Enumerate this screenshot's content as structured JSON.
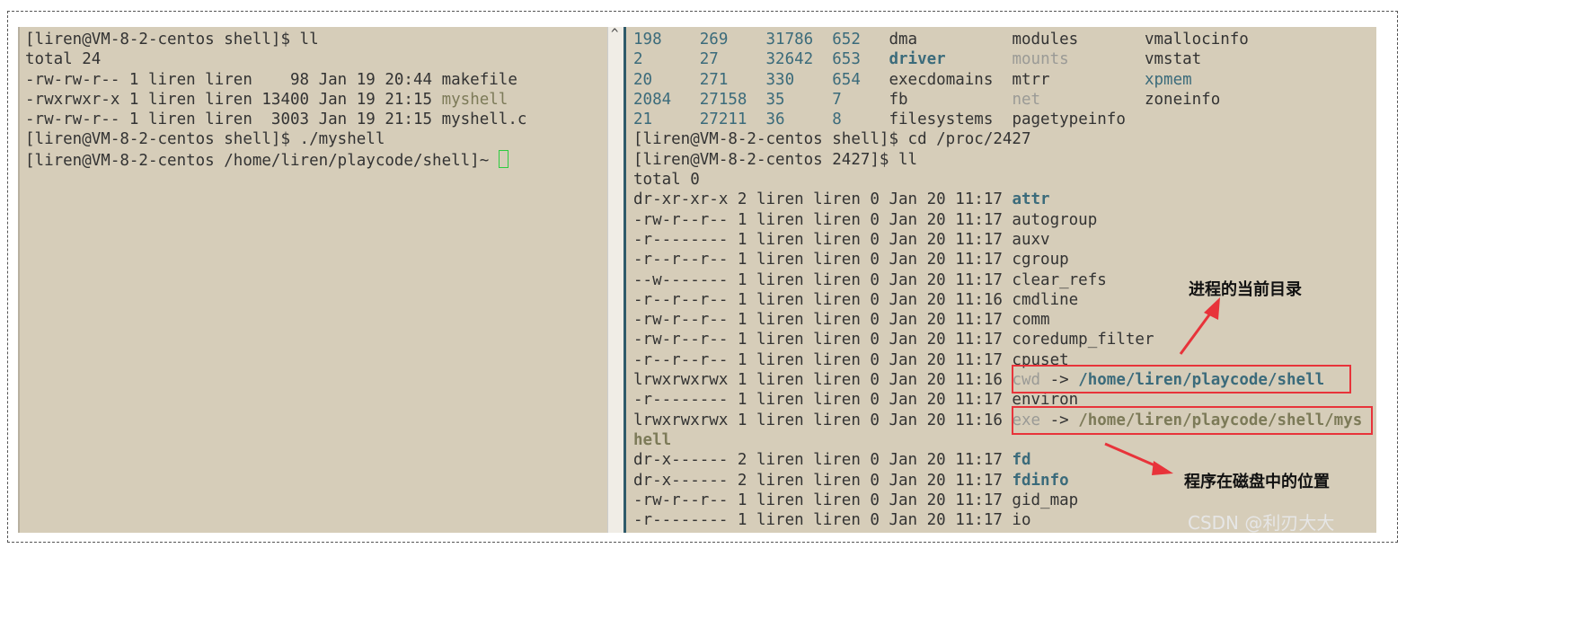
{
  "colors": {
    "background": "#d6cdb9",
    "blue": "#3b6b7b",
    "gray": "#9a9a96",
    "olive": "#7c7a58",
    "annotation": "#e8333a"
  },
  "left_terminal": {
    "lines": [
      [
        {
          "t": "[liren@VM-8-2-centos shell]$ ll"
        }
      ],
      [
        {
          "t": "total 24"
        }
      ],
      [
        {
          "t": "-rw-rw-r-- 1 liren liren    98 Jan 19 20:44 makefile"
        }
      ],
      [
        {
          "t": "-rwxrwxr-x 1 liren liren 13400 Jan 19 21:15 "
        },
        {
          "t": "myshell",
          "c": "olive"
        }
      ],
      [
        {
          "t": "-rw-rw-r-- 1 liren liren  3003 Jan 19 21:15 myshell.c"
        }
      ],
      [
        {
          "t": "[liren@VM-8-2-centos shell]$ ./myshell"
        }
      ],
      [
        {
          "t": "[liren@VM-8-2-centos /home/liren/playcode/shell]~ "
        },
        {
          "cursor": true
        }
      ]
    ]
  },
  "right_terminal": {
    "lines": [
      [
        {
          "t": "198    269    31786  652   ",
          "c": "blue"
        },
        {
          "t": "dma          modules       vmallocinfo"
        }
      ],
      [
        {
          "t": "2      27     32642  653   ",
          "c": "blue"
        },
        {
          "t": "driver",
          "c": "bblue"
        },
        {
          "t": "       "
        },
        {
          "t": "mounts",
          "c": "gray"
        },
        {
          "t": "        vmstat"
        }
      ],
      [
        {
          "t": "20     271    330    654   ",
          "c": "blue"
        },
        {
          "t": "execdomains  mtrr          "
        },
        {
          "t": "xpmem",
          "c": "blue"
        }
      ],
      [
        {
          "t": "2084   27158  35     7     ",
          "c": "blue"
        },
        {
          "t": "fb           "
        },
        {
          "t": "net",
          "c": "gray"
        },
        {
          "t": "           zoneinfo"
        }
      ],
      [
        {
          "t": "21     27211  36     8     ",
          "c": "blue"
        },
        {
          "t": "filesystems  pagetypeinfo"
        }
      ],
      [
        {
          "t": "[liren@VM-8-2-centos shell]$ cd /proc/2427"
        }
      ],
      [
        {
          "t": "[liren@VM-8-2-centos 2427]$ ll"
        }
      ],
      [
        {
          "t": "total 0"
        }
      ],
      [
        {
          "t": "dr-xr-xr-x 2 liren liren 0 Jan 20 11:17 "
        },
        {
          "t": "attr",
          "c": "bblue"
        }
      ],
      [
        {
          "t": "-rw-r--r-- 1 liren liren 0 Jan 20 11:17 autogroup"
        }
      ],
      [
        {
          "t": "-r-------- 1 liren liren 0 Jan 20 11:17 auxv"
        }
      ],
      [
        {
          "t": "-r--r--r-- 1 liren liren 0 Jan 20 11:17 cgroup"
        }
      ],
      [
        {
          "t": "--w------- 1 liren liren 0 Jan 20 11:17 clear_refs"
        }
      ],
      [
        {
          "t": "-r--r--r-- 1 liren liren 0 Jan 20 11:16 cmdline"
        }
      ],
      [
        {
          "t": "-rw-r--r-- 1 liren liren 0 Jan 20 11:17 comm"
        }
      ],
      [
        {
          "t": "-rw-r--r-- 1 liren liren 0 Jan 20 11:17 coredump_filter"
        }
      ],
      [
        {
          "t": "-r--r--r-- 1 liren liren 0 Jan 20 11:17 cpuset"
        }
      ],
      [
        {
          "t": "lrwxrwxrwx 1 liren liren 0 Jan 20 11:16 "
        },
        {
          "t": "cwd",
          "c": "gray"
        },
        {
          "t": " -> "
        },
        {
          "t": "/home/liren/playcode/shell",
          "c": "bblue"
        }
      ],
      [
        {
          "t": "-r-------- 1 liren liren 0 Jan 20 11:17 environ"
        }
      ],
      [
        {
          "t": "lrwxrwxrwx 1 liren liren 0 Jan 20 11:16 "
        },
        {
          "t": "exe",
          "c": "gray"
        },
        {
          "t": " -> "
        },
        {
          "t": "/home/liren/playcode/shell/mys",
          "c": "bolive"
        }
      ],
      [
        {
          "t": "hell",
          "c": "bolive"
        }
      ],
      [
        {
          "t": "dr-x------ 2 liren liren 0 Jan 20 11:17 "
        },
        {
          "t": "fd",
          "c": "bblue"
        }
      ],
      [
        {
          "t": "dr-x------ 2 liren liren 0 Jan 20 11:17 "
        },
        {
          "t": "fdinfo",
          "c": "bblue"
        }
      ],
      [
        {
          "t": "-rw-r--r-- 1 liren liren 0 Jan 20 11:17 gid_map"
        }
      ],
      [
        {
          "t": "-r-------- 1 liren liren 0 Jan 20 11:17 io"
        }
      ]
    ]
  },
  "annotations": {
    "cwd_note": "进程的当前目录",
    "exe_note": "程序在磁盘中的位置"
  },
  "watermark": "CSDN @利刃大大",
  "scroll_up": "^"
}
